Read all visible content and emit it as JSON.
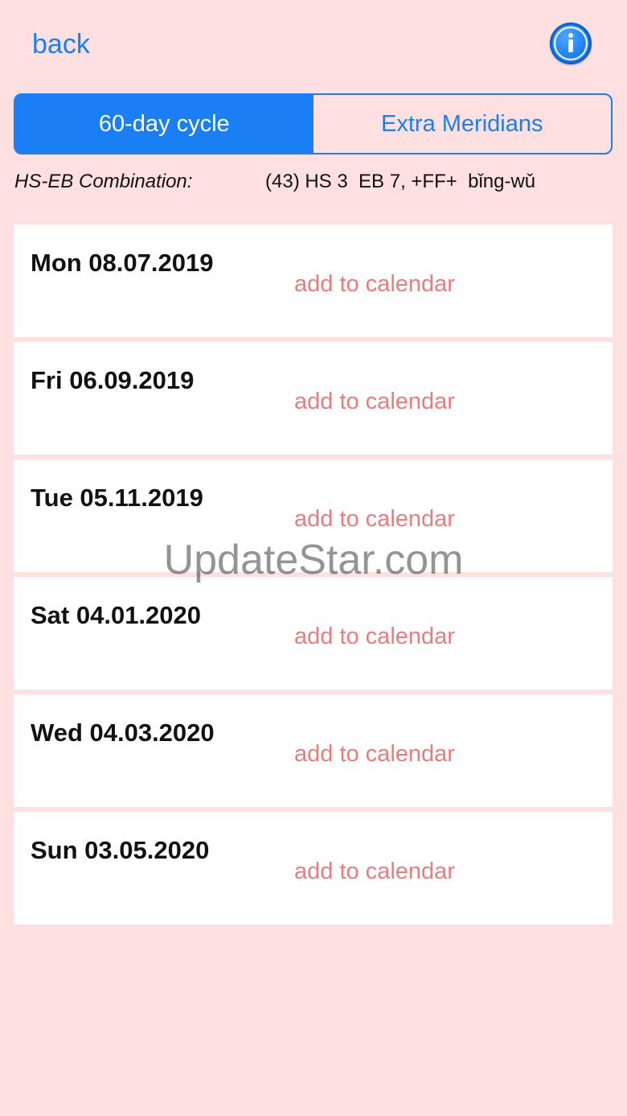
{
  "nav": {
    "back_label": "back",
    "info_icon": "info-icon",
    "accent_color": "#1a7ef5"
  },
  "segmented_control": {
    "segments": [
      {
        "label": "60-day cycle",
        "selected": true
      },
      {
        "label": "Extra Meridians",
        "selected": false
      }
    ]
  },
  "combination": {
    "label": "HS-EB Combination:",
    "value": "(43) HS 3  EB 7, +FF+  bǐng-wǔ"
  },
  "dates": [
    {
      "date": "Mon 08.07.2019",
      "action": "add to calendar"
    },
    {
      "date": "Fri 06.09.2019",
      "action": "add to calendar"
    },
    {
      "date": "Tue 05.11.2019",
      "action": "add to calendar"
    },
    {
      "date": "Sat 04.01.2020",
      "action": "add to calendar"
    },
    {
      "date": "Wed 04.03.2020",
      "action": "add to calendar"
    },
    {
      "date": "Sun 03.05.2020",
      "action": "add to calendar"
    }
  ],
  "watermark": "UpdateStar.com",
  "colors": {
    "background": "#fde0df",
    "action_text": "#f07a7a"
  }
}
